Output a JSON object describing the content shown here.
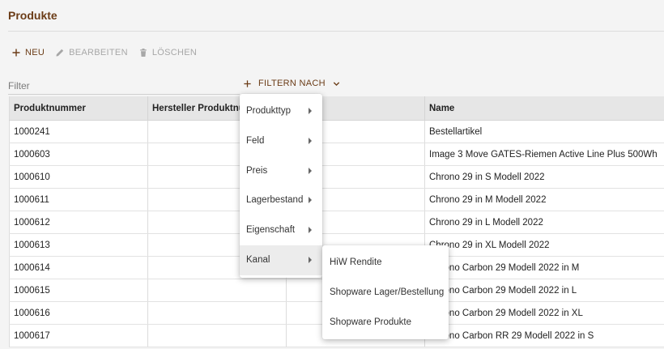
{
  "page": {
    "title": "Produkte"
  },
  "toolbar": {
    "new_label": "NEU",
    "edit_label": "BEARBEITEN",
    "delete_label": "LÖSCHEN"
  },
  "filter": {
    "label": "Filter",
    "filter_by_label": "FILTERN NACH"
  },
  "table": {
    "columns": [
      "Produktnummer",
      "Hersteller Produktnu",
      "",
      "Name"
    ],
    "rows": [
      [
        "1000241",
        "",
        "",
        "Bestellartikel"
      ],
      [
        "1000603",
        "",
        "",
        "Image 3 Move GATES-Riemen Active Line Plus 500Wh"
      ],
      [
        "1000610",
        "",
        "",
        "Chrono 29 in S Modell 2022"
      ],
      [
        "1000611",
        "",
        "",
        "Chrono 29 in M Modell 2022"
      ],
      [
        "1000612",
        "",
        "",
        "Chrono 29 in L Modell 2022"
      ],
      [
        "1000613",
        "",
        "",
        "Chrono 29 in XL Modell 2022"
      ],
      [
        "1000614",
        "",
        "",
        "Chrono Carbon 29 Modell 2022 in M"
      ],
      [
        "1000615",
        "",
        "",
        "Chrono Carbon 29 Modell 2022 in L"
      ],
      [
        "1000616",
        "",
        "",
        "Chrono Carbon 29 Modell 2022 in XL"
      ],
      [
        "1000617",
        "",
        "",
        "Chrono Carbon RR 29 Modell 2022 in S"
      ]
    ]
  },
  "filter_menu": {
    "items": [
      "Produkttyp",
      "Feld",
      "Preis",
      "Lagerbestand",
      "Eigenschaft",
      "Kanal"
    ],
    "highlighted": "Kanal"
  },
  "channel_submenu": {
    "items": [
      "HiW Rendite",
      "Shopware Lager/Bestellung",
      "Shopware Produkte"
    ]
  },
  "colors": {
    "accent": "#6b3c17",
    "disabled": "#a7a7a7",
    "header_bg": "#e6e6e6",
    "page_bg": "#f4f4f4",
    "highlight": "#ececec"
  },
  "icons": {
    "new": "plus-icon",
    "edit": "pencil-icon",
    "delete": "trash-icon",
    "filter_add": "plus-icon",
    "filter_expand": "chevron-down-icon",
    "submenu": "caret-right-icon"
  }
}
